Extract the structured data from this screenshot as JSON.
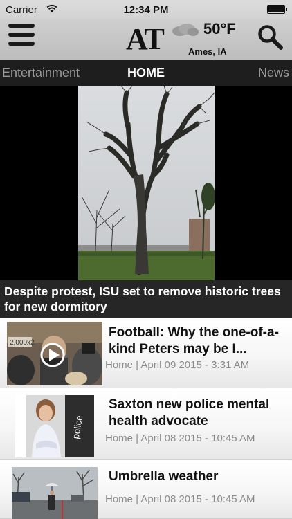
{
  "status_bar": {
    "carrier": "Carrier",
    "time": "12:34 PM"
  },
  "header": {
    "logo": "AT",
    "temperature": "50°F",
    "location": "Ames, IA",
    "weather_icon": "cloudy-icon"
  },
  "tabs": {
    "left": "Entertainment",
    "center": "HOME",
    "right": "News"
  },
  "hero": {
    "caption": "Despite protest, ISU set to remove historic trees for new dormitory"
  },
  "articles": [
    {
      "title": "Football: Why the one-of-a-kind Peters may be I...",
      "section": "Home",
      "date": "April 09 2015 - 3:31 AM",
      "has_video": true
    },
    {
      "title": "Saxton new police mental health advocate",
      "section": "Home",
      "date": "April 08 2015 - 10:45 AM",
      "has_video": false
    },
    {
      "title": "Umbrella weather",
      "section": "Home",
      "date": "April 08 2015 - 10:45 AM",
      "has_video": false
    }
  ]
}
